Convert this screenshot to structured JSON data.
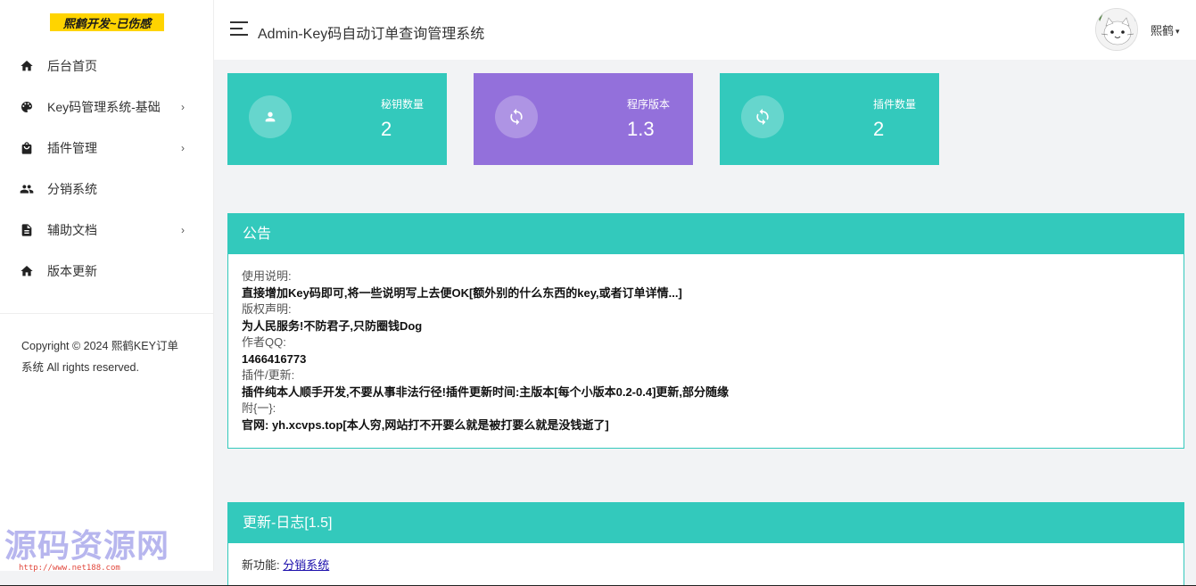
{
  "brand": {
    "text": "熙鹤开发~已伤感"
  },
  "sidebar": {
    "items": [
      {
        "label": "后台首页",
        "icon": "home-icon",
        "has_submenu": false
      },
      {
        "label": "Key码管理系统-基础",
        "icon": "palette-icon",
        "has_submenu": true
      },
      {
        "label": "插件管理",
        "icon": "bag-icon",
        "has_submenu": true
      },
      {
        "label": "分销系统",
        "icon": "people-icon",
        "has_submenu": false
      },
      {
        "label": "辅助文档",
        "icon": "document-icon",
        "has_submenu": true
      },
      {
        "label": "版本更新",
        "icon": "home-icon",
        "has_submenu": false
      }
    ],
    "chevron": "›",
    "copyright_line1": "Copyright © 2024 熙鹤KEY订单",
    "copyright_line2": "系统 All rights reserved."
  },
  "header": {
    "title": "Admin-Key码自动订单查询管理系统",
    "user_name": "熙鹤",
    "caret": "▾"
  },
  "cards": [
    {
      "label": "秘钥数量",
      "value": "2",
      "icon": "user-icon",
      "color": "#33c9bc"
    },
    {
      "label": "程序版本",
      "value": "1.3",
      "icon": "refresh-icon",
      "color": "#9370db"
    },
    {
      "label": "插件数量",
      "value": "2",
      "icon": "refresh-icon",
      "color": "#33c9bc"
    }
  ],
  "notice": {
    "title": "公告",
    "entries": [
      {
        "label": "使用说明:",
        "value": "直接增加Key码即可,将一些说明写上去便OK[额外别的什么东西的key,或者订单详情...]"
      },
      {
        "label": "版权声明:",
        "value": "为人民服务!不防君子,只防圈钱Dog"
      },
      {
        "label": "作者QQ:",
        "value": "1466416773"
      },
      {
        "label": "插件/更新:",
        "value": "插件纯本人顺手开发,不要从事非法行径!插件更新时间:主版本[每个小版本0.2-0.4]更新,部分随缘"
      },
      {
        "label": "附{一}:",
        "value": "官网: yh.xcvps.top[本人穷,网站打不开要么就是被打要么就是没钱逝了]"
      }
    ]
  },
  "changelog": {
    "title": "更新-日志[1.5]",
    "line_label": "新功能: ",
    "line_link": "分销系统"
  },
  "watermark": {
    "main": "源码资源网",
    "url": "http://www.net188.com"
  },
  "colors": {
    "teal": "#33c9bc",
    "purple": "#9370db",
    "brand_yellow": "#ffd400"
  }
}
